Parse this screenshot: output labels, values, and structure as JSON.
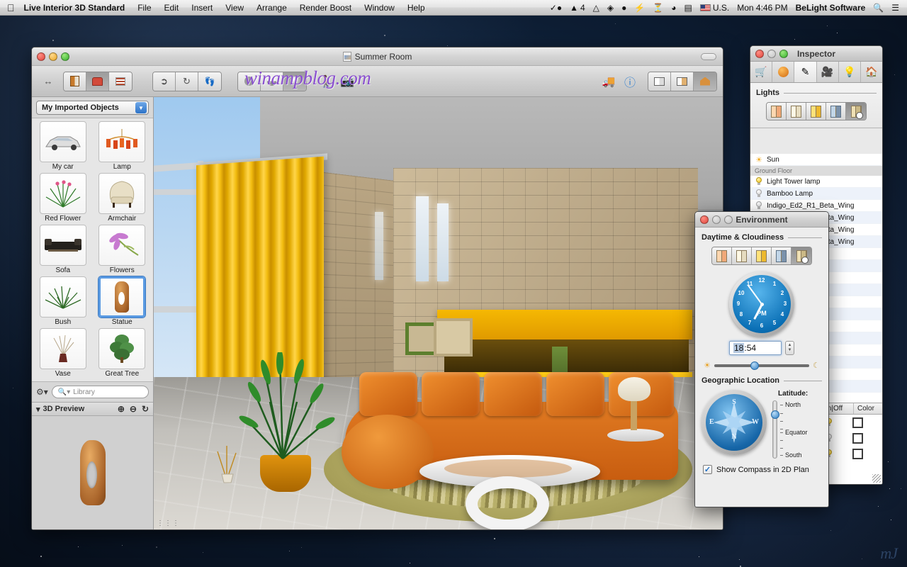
{
  "menubar": {
    "apple_icon": "apple-icon",
    "app_name": "Live Interior 3D Standard",
    "menus": [
      "File",
      "Edit",
      "Insert",
      "View",
      "Arrange",
      "Render Boost",
      "Window",
      "Help"
    ],
    "status_icons": [
      "checkmark-circle-icon",
      "adobe-icon",
      "google-drive-icon",
      "dropbox-globe-icon",
      "evernote-icon",
      "flash-icon",
      "time-machine-icon",
      "wifi-icon",
      "battery-icon"
    ],
    "adobe_badge": "4",
    "input_language": "U.S.",
    "clock": "Mon 4:46 PM",
    "user": "BeLight Software",
    "search_icon": "search-icon",
    "notification_icon": "notification-center-icon"
  },
  "main_window": {
    "document_title": "Summer Room",
    "document_icon": "document-icon",
    "watermark": "winampblog.com",
    "toolbar": {
      "resize_icon": "arrows-horizontal-icon",
      "mode_buttons": [
        {
          "name": "floor-plan-button",
          "icon": "building-icon",
          "selected": false
        },
        {
          "name": "furniture-button",
          "icon": "armchair-icon",
          "selected": true
        },
        {
          "name": "list-view-button",
          "icon": "list-icon",
          "selected": false
        }
      ],
      "tool_buttons": [
        {
          "name": "select-tool",
          "icon": "arrow-cursor-icon",
          "selected": false
        },
        {
          "name": "rotate-tool",
          "icon": "rotate-icon",
          "selected": false
        },
        {
          "name": "measure-tool",
          "icon": "footprints-icon",
          "selected": false
        }
      ],
      "render_buttons": [
        {
          "name": "flat-render-button",
          "icon": "sphere-flat-icon",
          "selected": false
        },
        {
          "name": "shaded-render-button",
          "icon": "sphere-shaded-icon",
          "selected": false
        },
        {
          "name": "realistic-render-button",
          "icon": "sphere-realistic-icon",
          "selected": true
        }
      ],
      "walk_button": {
        "name": "walkthrough-button",
        "icon": "walking-person-icon"
      },
      "camera_button": {
        "name": "camera-button",
        "icon": "camera-icon"
      },
      "elevate_button": {
        "name": "elevation-button",
        "icon": "forklift-icon"
      },
      "info_button": {
        "name": "info-button",
        "icon": "info-circle-icon"
      },
      "view_buttons": [
        {
          "name": "split-view-button",
          "icon": "split-view-icon",
          "selected": false
        },
        {
          "name": "plan-3d-view-button",
          "icon": "plan-3d-icon",
          "selected": false
        },
        {
          "name": "3d-view-button",
          "icon": "house-3d-icon",
          "selected": true
        }
      ]
    }
  },
  "sidebar": {
    "library_select": "My Imported Objects",
    "dropdown_icon": "chevron-down-icon",
    "objects": [
      {
        "label": "My car",
        "icon": "car-thumb",
        "selected": false
      },
      {
        "label": "Lamp",
        "icon": "chandelier-thumb",
        "selected": false
      },
      {
        "label": "Red Flower",
        "icon": "red-flower-thumb",
        "selected": false
      },
      {
        "label": "Armchair",
        "icon": "armchair-thumb",
        "selected": false
      },
      {
        "label": "Sofa",
        "icon": "sofa-thumb",
        "selected": false
      },
      {
        "label": "Flowers",
        "icon": "flowers-thumb",
        "selected": false
      },
      {
        "label": "Bush",
        "icon": "bush-thumb",
        "selected": false
      },
      {
        "label": "Statue",
        "icon": "statue-thumb",
        "selected": true
      },
      {
        "label": "Vase",
        "icon": "vase-thumb",
        "selected": false
      },
      {
        "label": "Great Tree",
        "icon": "tree-thumb",
        "selected": false
      }
    ],
    "gear_icon": "gear-icon",
    "search_placeholder": "Library",
    "search_value": "",
    "search_icon": "search-icon",
    "preview": {
      "title": "3D Preview",
      "disclosure_icon": "triangle-down-icon",
      "zoom_in_icon": "zoom-in-icon",
      "zoom_out_icon": "zoom-out-icon",
      "rotate_icon": "rotate-arrow-icon"
    }
  },
  "inspector": {
    "title": "Inspector",
    "tabs": [
      {
        "name": "object-tab",
        "icon": "furniture-ruler-icon",
        "selected": false
      },
      {
        "name": "material-tab",
        "icon": "orange-sphere-icon",
        "selected": false
      },
      {
        "name": "edit-tab",
        "icon": "pencil-pad-icon",
        "selected": true
      },
      {
        "name": "camera-tab",
        "icon": "video-camera-icon",
        "selected": false
      },
      {
        "name": "light-tab",
        "icon": "lightbulb-icon",
        "selected": false
      },
      {
        "name": "building-tab",
        "icon": "house-icon",
        "selected": false
      }
    ],
    "section_title": "Lights",
    "light_modes": [
      {
        "name": "light-mode-warm",
        "icon": "window-warm-icon",
        "selected": false
      },
      {
        "name": "light-mode-neutral",
        "icon": "window-neutral-icon",
        "selected": false
      },
      {
        "name": "light-mode-bright",
        "icon": "window-bright-icon",
        "selected": false
      },
      {
        "name": "light-mode-cool",
        "icon": "window-cool-icon",
        "selected": false
      },
      {
        "name": "light-mode-auto",
        "icon": "window-clock-icon",
        "selected": true
      }
    ],
    "list": [
      {
        "type": "item",
        "label": "Sun",
        "icon": "sun-icon",
        "state": "on"
      },
      {
        "type": "group",
        "label": "Ground Floor"
      },
      {
        "type": "item",
        "label": "Light Tower lamp",
        "icon": "bulb-icon",
        "state": "on"
      },
      {
        "type": "item",
        "label": "Bamboo Lamp",
        "icon": "bulb-icon",
        "state": "off"
      },
      {
        "type": "item",
        "label": "Indigo_Ed2_R1_Beta_Wing",
        "icon": "bulb-icon",
        "state": "off"
      },
      {
        "type": "item",
        "label": "Indigo_Ed2_R1_Beta_Wing",
        "icon": "bulb-icon",
        "state": "off"
      },
      {
        "type": "item",
        "label": "Indigo_Ed2_R1_Beta_Wing",
        "icon": "bulb-icon",
        "state": "off"
      },
      {
        "type": "item",
        "label": "Indigo_Ed2_R1_Beta_Wing",
        "icon": "bulb-icon",
        "state": "off"
      }
    ],
    "columns": [
      "On|Off",
      "Color"
    ],
    "color_rows": [
      {
        "icon": "bulb-icon",
        "state": "on",
        "color": "#ffffff"
      },
      {
        "icon": "bulb-icon",
        "state": "off",
        "color": "#ffffff"
      },
      {
        "icon": "bulb-icon",
        "state": "on",
        "color": "#ffffff"
      }
    ],
    "resize_grip": "resize-grip-icon"
  },
  "environment": {
    "title": "Environment",
    "daytime_title": "Daytime & Cloudiness",
    "cloud_modes": [
      {
        "name": "cloud-mode-sunset",
        "icon": "window-sunset-icon",
        "selected": false
      },
      {
        "name": "cloud-mode-overcast",
        "icon": "window-overcast-icon",
        "selected": false
      },
      {
        "name": "cloud-mode-sunny",
        "icon": "window-sunny-icon",
        "selected": false
      },
      {
        "name": "cloud-mode-night",
        "icon": "window-night-icon",
        "selected": false
      },
      {
        "name": "cloud-mode-auto",
        "icon": "window-clock-icon",
        "selected": true
      }
    ],
    "clock": {
      "numbers": [
        "12",
        "1",
        "2",
        "3",
        "4",
        "5",
        "6",
        "7",
        "8",
        "9",
        "10",
        "11"
      ],
      "period": "PM",
      "hour_angle": 207,
      "minute_angle": 324
    },
    "time_value": "18:54",
    "time_value_hours": "18",
    "time_value_sep": ":",
    "time_value_minutes": "54",
    "stepper_icon": "stepper-icon",
    "daylight_slider": {
      "left_icon": "sunrise-icon",
      "right_icon": "moon-icon",
      "position_pct": 38
    },
    "geo_title": "Geographic Location",
    "compass_icon": "compass-rose-icon",
    "compass_directions": [
      "N",
      "E",
      "S",
      "W"
    ],
    "latitude_label": "Latitude:",
    "latitude_ticks": [
      "North",
      "Equator",
      "South"
    ],
    "latitude_knob_pct": 16,
    "checkbox": {
      "label": "Show Compass in 2D Plan",
      "checked": true,
      "icon": "checkmark-icon"
    }
  },
  "viewport": {
    "grip_icon": "resize-grip-icon",
    "scene_description": "3D rendered living room with yellow curtains, stone wall, orange sectional sofa and oval coffee table"
  },
  "desktop": {
    "watermark": "mJ"
  }
}
